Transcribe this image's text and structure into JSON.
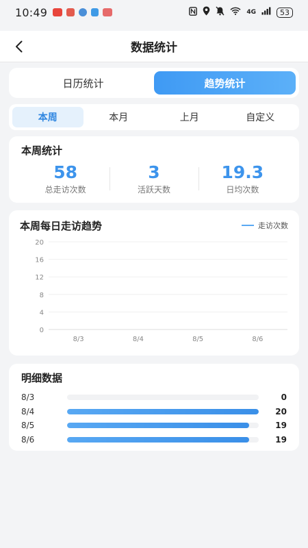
{
  "status_bar": {
    "time": "10:49",
    "network": "4G",
    "battery": "53",
    "icons": [
      "nfc-icon",
      "location-icon",
      "mute-icon",
      "wifi-icon",
      "signal-icon"
    ]
  },
  "header": {
    "title": "数据统计"
  },
  "tabs": [
    {
      "label": "日历统计",
      "active": false
    },
    {
      "label": "趋势统计",
      "active": true
    }
  ],
  "periods": [
    {
      "label": "本周",
      "active": true
    },
    {
      "label": "本月",
      "active": false
    },
    {
      "label": "上月",
      "active": false
    },
    {
      "label": "自定义",
      "active": false
    }
  ],
  "summary": {
    "title": "本周统计",
    "stats": [
      {
        "value": "58",
        "label": "总走访次数"
      },
      {
        "value": "3",
        "label": "活跃天数"
      },
      {
        "value": "19.3",
        "label": "日均次数"
      }
    ]
  },
  "trend": {
    "title": "本周每日走访趋势",
    "legend": "走访次数"
  },
  "chart_data": {
    "type": "line",
    "categories": [
      "8/3",
      "8/4",
      "8/5",
      "8/6"
    ],
    "series": [
      {
        "name": "走访次数",
        "values": []
      }
    ],
    "ylim": [
      0,
      20
    ],
    "yticks": [
      0,
      4,
      8,
      12,
      16,
      20
    ],
    "grid": true,
    "legend_position": "top-right"
  },
  "detail": {
    "title": "明细数据",
    "max": 20,
    "rows": [
      {
        "date": "8/3",
        "value": 0
      },
      {
        "date": "8/4",
        "value": 20
      },
      {
        "date": "8/5",
        "value": 19
      },
      {
        "date": "8/6",
        "value": 19
      }
    ]
  },
  "colors": {
    "accent": "#3d94ec",
    "active_tab_bg": "#4fa6f6",
    "period_active_bg": "#e5f1fc"
  }
}
